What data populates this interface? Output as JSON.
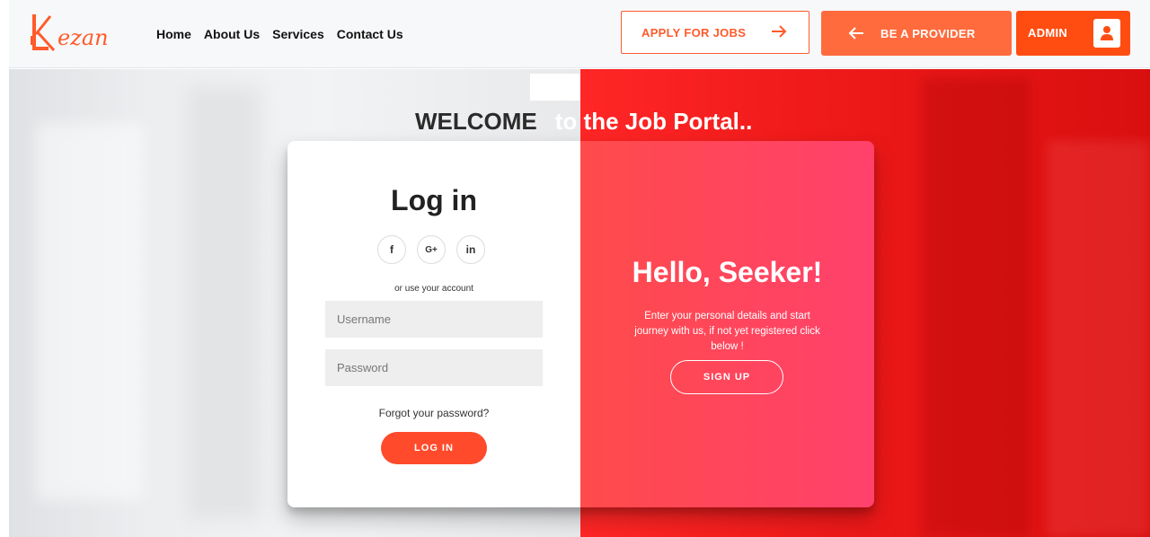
{
  "brand": {
    "logo_text": "Kezan",
    "accent": "#ff5b2b"
  },
  "nav": {
    "home": "Home",
    "about": "About Us",
    "services": "Services",
    "contact": "Contact Us"
  },
  "header_actions": {
    "apply_label": "APPLY FOR JOBS",
    "apply_icon": "arrow-right-icon",
    "provider_label": "BE A PROVIDER",
    "provider_icon": "arrow-left-icon",
    "admin_label": "ADMIN",
    "admin_icon": "user-icon"
  },
  "hero": {
    "welcome": "WELCOME",
    "subtitle": "to the Job Portal.."
  },
  "login": {
    "title": "Log in",
    "socials": [
      {
        "label": "f",
        "icon": "facebook-icon"
      },
      {
        "label": "G+",
        "icon": "google-plus-icon"
      },
      {
        "label": "in",
        "icon": "linkedin-icon"
      }
    ],
    "alt_text": "or use your account",
    "username_placeholder": "Username",
    "password_placeholder": "Password",
    "forgot": "Forgot your password?",
    "submit": "LOG IN"
  },
  "signup_panel": {
    "title": "Hello, Seeker!",
    "text": "Enter your personal details and start journey with us, if not yet registered click below !",
    "button": "SIGN UP"
  },
  "colors": {
    "primary_orange": "#ff6b3d",
    "admin_orange": "#ff4d12",
    "panel_gradient_start": "#ff4b4b",
    "panel_gradient_end": "#ff416c",
    "background_red": "#f01a1a"
  }
}
